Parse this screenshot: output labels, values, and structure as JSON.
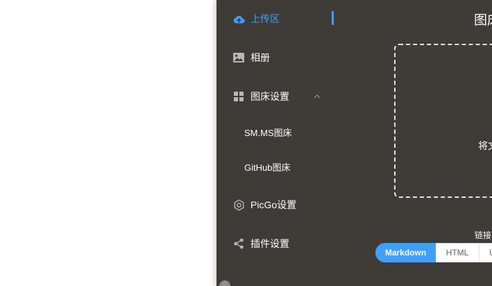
{
  "sidebar": {
    "items": [
      {
        "label": "上传区",
        "icon": "cloud-upload-icon",
        "active": true
      },
      {
        "label": "相册",
        "icon": "image-icon"
      },
      {
        "label": "图床设置",
        "icon": "grid-icon",
        "expanded": true
      },
      {
        "label": "PicGo设置",
        "icon": "gear-icon"
      },
      {
        "label": "插件设置",
        "icon": "share-icon"
      }
    ],
    "subitems": [
      {
        "label": "SM.MS图床"
      },
      {
        "label": "GitHub图床"
      }
    ]
  },
  "main": {
    "title": "图床",
    "drop_text": "将文",
    "link_format_label": "链接",
    "formats": [
      "Markdown",
      "HTML",
      "U"
    ],
    "selected_format": "Markdown"
  },
  "colors": {
    "accent": "#409eff",
    "app_background": "#3f3c37",
    "icon_gray": "#b8b8b8"
  }
}
